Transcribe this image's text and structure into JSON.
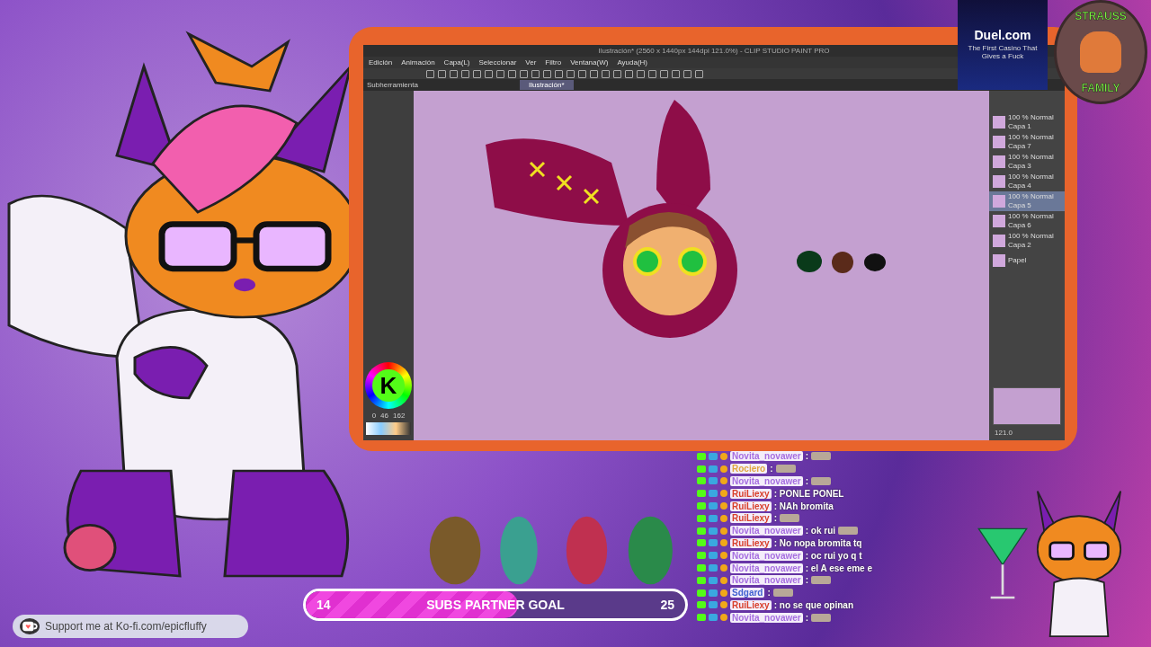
{
  "editor": {
    "title": "Ilustración* (2560 x 1440px 144dpi 121.0%) - CLIP STUDIO PAINT PRO",
    "menu": [
      "Edición",
      "Animación",
      "Capa(L)",
      "Seleccionar",
      "Ver",
      "Filtro",
      "Ventana(W)",
      "Ayuda(H)"
    ],
    "panel_title": "Subherramienta",
    "tabs": [
      {
        "label": "Ilustración*",
        "selected": true
      }
    ],
    "color_readout": [
      "0",
      "46",
      "162"
    ],
    "layers": [
      {
        "name": "Capa 1",
        "mode": "100 % Normal",
        "selected": false
      },
      {
        "name": "Capa 7",
        "mode": "100 % Normal",
        "selected": false
      },
      {
        "name": "Capa 3",
        "mode": "100 % Normal",
        "selected": false
      },
      {
        "name": "Capa 4",
        "mode": "100 % Normal",
        "selected": false
      },
      {
        "name": "Capa 5",
        "mode": "100 % Normal",
        "selected": true
      },
      {
        "name": "Capa 6",
        "mode": "100 % Normal",
        "selected": false
      },
      {
        "name": "Capa 2",
        "mode": "100 % Normal",
        "selected": false
      },
      {
        "name": "Papel",
        "selected": false
      }
    ],
    "zoom": "121.0"
  },
  "kick_logo": {
    "letter": "K"
  },
  "sponsor": {
    "name": "Duel.com",
    "tagline": "The First Casino That Gives a Fuck"
  },
  "badge": {
    "top": "STRAUSS",
    "bottom": "FAMILY"
  },
  "chat": [
    {
      "user": "Novita_novawer",
      "color": "#a66ee0",
      "message": ":",
      "emote": true
    },
    {
      "user": "Rociero",
      "color": "#e0a640",
      "message": ":",
      "emote": true
    },
    {
      "user": "Novita_novawer",
      "color": "#a66ee0",
      "message": ":",
      "emote": true
    },
    {
      "user": "RuiLiexy",
      "color": "#d8402c",
      "message": ": PONLE PONEL",
      "emote": false
    },
    {
      "user": "RuiLiexy",
      "color": "#d8402c",
      "message": ": NAh bromita",
      "emote": false
    },
    {
      "user": "RuiLiexy",
      "color": "#d8402c",
      "message": ":",
      "emote": true
    },
    {
      "user": "Novita_novawer",
      "color": "#a66ee0",
      "message": ": ok rui",
      "emote": true
    },
    {
      "user": "RuiLiexy",
      "color": "#d8402c",
      "message": ": No nopa bromita tq",
      "emote": false
    },
    {
      "user": "Novita_novawer",
      "color": "#a66ee0",
      "message": ": oc rui yo q t",
      "emote": false
    },
    {
      "user": "Novita_novawer",
      "color": "#a66ee0",
      "message": ": el A ese eme e",
      "emote": false
    },
    {
      "user": "Novita_novawer",
      "color": "#a66ee0",
      "message": ":",
      "emote": true
    },
    {
      "user": "Sdgard",
      "color": "#4060d0",
      "message": ":",
      "emote": true
    },
    {
      "user": "RuiLiexy",
      "color": "#d8402c",
      "message": ": no se que opinan",
      "emote": false
    },
    {
      "user": "Novita_novawer",
      "color": "#a66ee0",
      "message": ":",
      "emote": true
    }
  ],
  "goal": {
    "current": "14",
    "label": "SUBS PARTNER GOAL",
    "target": "25",
    "level": 0.56
  },
  "kofi": {
    "text": "Support me at Ko-fi.com/epicfluffy"
  }
}
